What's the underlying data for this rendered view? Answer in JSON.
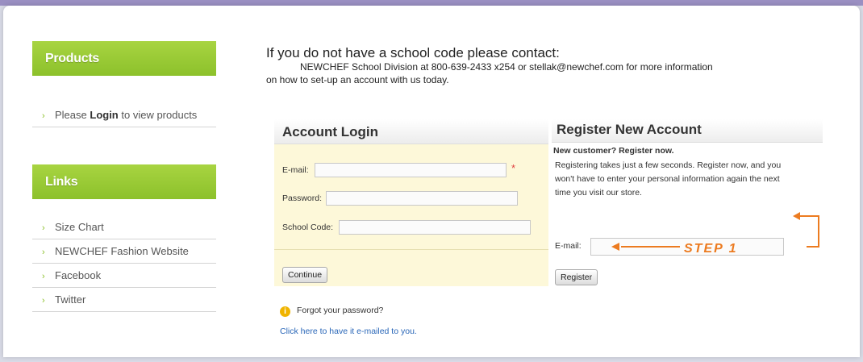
{
  "colors": {
    "accent_green": "#8cc12b",
    "annotation_orange": "#ec7b20",
    "link_blue": "#2a67b8",
    "login_panel_bg": "#fdf8d9"
  },
  "sidebar": {
    "products": {
      "heading": "Products",
      "items": [
        {
          "pre": "Please ",
          "bold": "Login",
          "post": " to view products"
        }
      ]
    },
    "links": {
      "heading": "Links",
      "items": [
        {
          "label": "Size Chart"
        },
        {
          "label": "NEWCHEF Fashion Website"
        },
        {
          "label": "Facebook"
        },
        {
          "label": "Twitter"
        }
      ]
    }
  },
  "intro": {
    "title": "If you do not have a school code please contact:",
    "line1": "NEWCHEF School Division at 800-639-2433 x254 or stellak@newchef.com for more information",
    "line2": "on how to set-up an account with us today."
  },
  "login": {
    "title": "Account Login",
    "email_label": "E-mail:",
    "email_value": "",
    "required_mark": "*",
    "password_label": "Password:",
    "password_value": "",
    "school_code_label": "School Code:",
    "school_code_value": "",
    "continue_button": "Continue"
  },
  "forgot": {
    "text": "Forgot your password?",
    "link": "Click here to have it e-mailed to you.",
    "icon": "info-icon"
  },
  "register": {
    "title": "Register New Account",
    "subtitle": "New customer? Register now.",
    "desc_line1": "Registering takes just a few seconds. Register now, and you",
    "desc_line2": "won't have to enter your personal information again the next",
    "desc_line3": "time you visit our store.",
    "email_label": "E-mail:",
    "email_value": "",
    "register_button": "Register"
  },
  "annotation": {
    "step_label": "STEP 1"
  }
}
